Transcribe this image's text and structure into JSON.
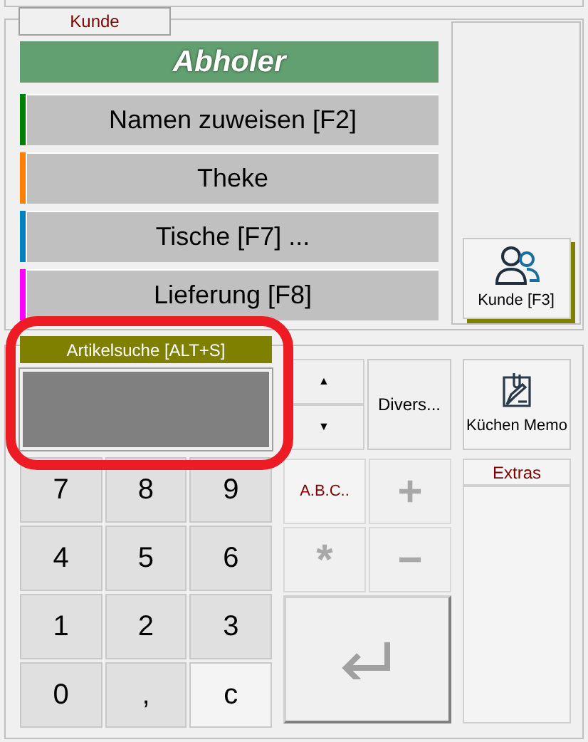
{
  "customer_group": {
    "tab_label": "Kunde",
    "order_type": "Abholer",
    "options": [
      {
        "label": "Namen zuweisen [F2]",
        "color": "#008000"
      },
      {
        "label": "Theke",
        "color": "#ff8000"
      },
      {
        "label": "Tische [F7] ...",
        "color": "#0080c0"
      },
      {
        "label": "Lieferung [F8]",
        "color": "#ff00ff"
      }
    ],
    "customer_button": "Kunde [F3]"
  },
  "article_search": {
    "label": "Artikelsuche [ALT+S]"
  },
  "keypad": [
    {
      "label": "7",
      "kind": "digit"
    },
    {
      "label": "8",
      "kind": "digit"
    },
    {
      "label": "9",
      "kind": "digit"
    },
    {
      "label": "4",
      "kind": "digit"
    },
    {
      "label": "5",
      "kind": "digit"
    },
    {
      "label": "6",
      "kind": "digit"
    },
    {
      "label": "1",
      "kind": "digit"
    },
    {
      "label": "2",
      "kind": "digit"
    },
    {
      "label": "3",
      "kind": "digit"
    },
    {
      "label": "0",
      "kind": "digit"
    },
    {
      "label": ",",
      "kind": "digit"
    },
    {
      "label": "c",
      "kind": "clear"
    }
  ],
  "scroll_buttons": [
    "▲",
    "▼"
  ],
  "divers_button": "Divers...",
  "kitchen_memo_button": "Küchen Memo",
  "abc_button": "A.B.C..",
  "operators": [
    "+",
    "*",
    "−"
  ],
  "extras": {
    "label": "Extras"
  }
}
